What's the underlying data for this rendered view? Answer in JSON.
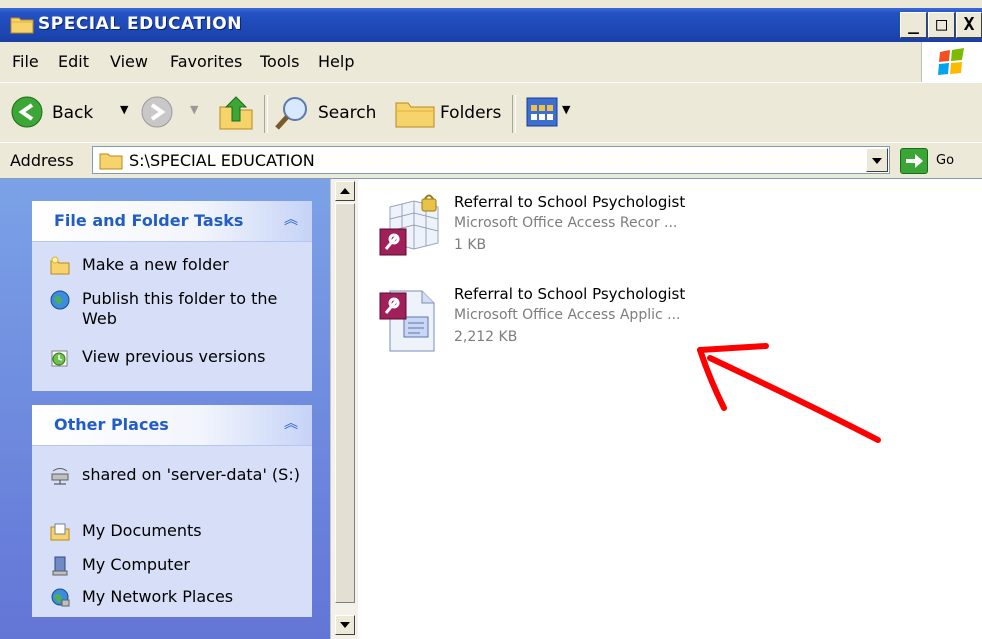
{
  "window": {
    "title": "SPECIAL EDUCATION",
    "controls": {
      "minimize": "_",
      "maximize": "□",
      "close": "X"
    }
  },
  "menubar": {
    "items": [
      "File",
      "Edit",
      "View",
      "Favorites",
      "Tools",
      "Help"
    ]
  },
  "toolbar": {
    "back_label": "Back",
    "search_label": "Search",
    "folders_label": "Folders"
  },
  "address": {
    "label": "Address",
    "value": "S:\\SPECIAL EDUCATION",
    "go_label": "Go"
  },
  "tasks_panel": {
    "title": "File and Folder Tasks",
    "items": [
      {
        "label": "Make a new folder",
        "icon": "new-folder-icon"
      },
      {
        "label": "Publish this folder to the Web",
        "icon": "publish-web-icon"
      },
      {
        "label": "View previous versions",
        "icon": "previous-versions-icon"
      }
    ]
  },
  "places_panel": {
    "title": "Other Places",
    "items": [
      {
        "label": "shared on 'server-data' (S:)",
        "icon": "network-drive-icon"
      },
      {
        "label": "My Documents",
        "icon": "my-documents-icon"
      },
      {
        "label": "My Computer",
        "icon": "my-computer-icon"
      },
      {
        "label": "My Network Places",
        "icon": "my-network-places-icon"
      }
    ]
  },
  "files": [
    {
      "name": "Referral to School Psychologist",
      "type": "Microsoft Office Access Recor ...",
      "size": "1 KB",
      "icon": "access-record-locking-icon"
    },
    {
      "name": "Referral to School Psychologist",
      "type": "Microsoft Office Access Applic ...",
      "size": "2,212 KB",
      "icon": "access-application-icon"
    }
  ],
  "colors": {
    "titlebar": "#1f4ab8",
    "taskpane_bg": "#6f8ce0",
    "panel_title": "#215dc6",
    "annotation_arrow": "#ff0000"
  }
}
